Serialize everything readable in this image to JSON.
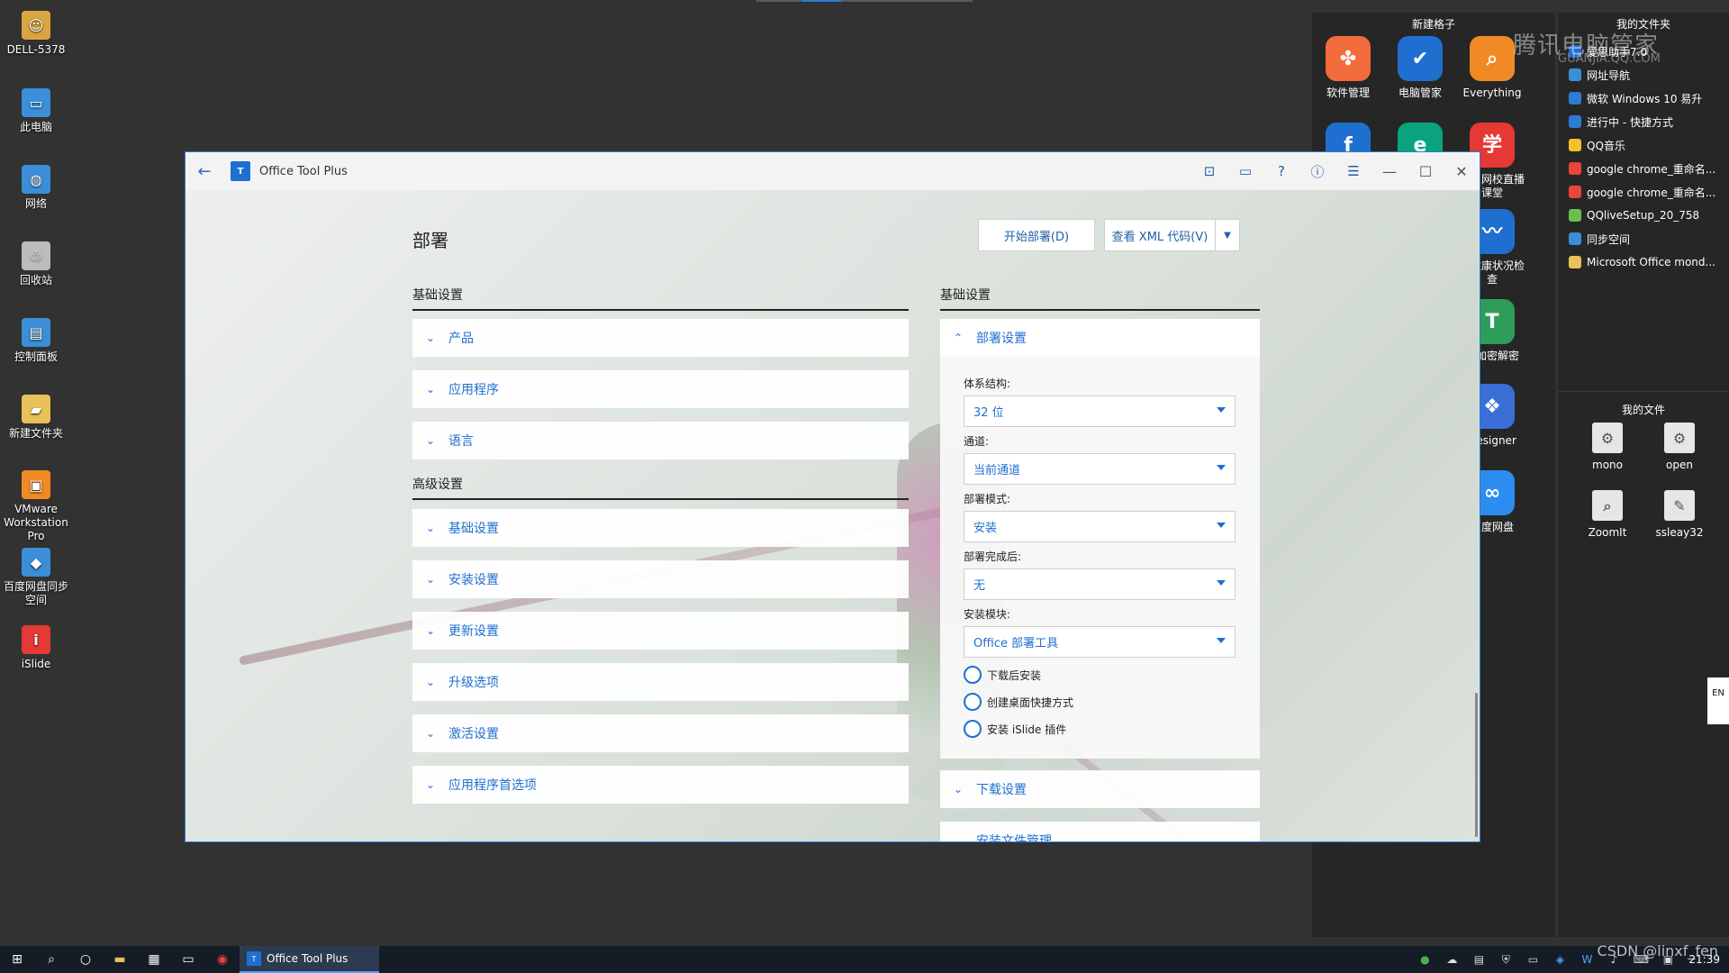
{
  "desktop": {
    "icons": [
      {
        "label": "DELL-5378",
        "icon": "user-folder-icon",
        "color": "#d9a441"
      },
      {
        "label": "此电脑",
        "icon": "computer-icon",
        "color": "#3a8fd8"
      },
      {
        "label": "网络",
        "icon": "network-icon",
        "color": "#3a8fd8"
      },
      {
        "label": "回收站",
        "icon": "recycle-bin-icon",
        "color": "#bcbcbc"
      },
      {
        "label": "控制面板",
        "icon": "control-panel-icon",
        "color": "#3a8fd8"
      },
      {
        "label": "新建文件夹",
        "icon": "folder-icon",
        "color": "#e8c15a"
      },
      {
        "label": "VMware Workstation Pro",
        "icon": "vmware-icon",
        "color": "#f08a24"
      },
      {
        "label": "百度网盘同步空间",
        "icon": "baidu-sync-icon",
        "color": "#3a8fd8"
      },
      {
        "label": "iSlide",
        "icon": "islide-icon",
        "color": "#e53935"
      }
    ]
  },
  "fence_left": {
    "title": "新建格子",
    "icons": [
      {
        "label": "软件管理",
        "icon": "software-manager-icon",
        "color": "#f26b3a"
      },
      {
        "label": "电脑管家",
        "icon": "pc-manager-icon",
        "color": "#1f6fd0"
      },
      {
        "label": "Everything",
        "icon": "everything-search-icon",
        "color": "#f08a24"
      },
      {
        "label": "",
        "icon": "flash-icon",
        "color": "#1f6fd0"
      },
      {
        "label": "",
        "icon": "edge-icon",
        "color": "#0aa37f"
      },
      {
        "label": "希思网校直播课堂",
        "icon": "school-icon",
        "color": "#e53935"
      },
      {
        "label": "脑健康状况检查",
        "icon": "health-check-icon",
        "color": "#1f6fd0"
      },
      {
        "label": "字加密解密",
        "icon": "encrypt-icon",
        "color": "#2e9d5a"
      },
      {
        "label": "Designer",
        "icon": "designer-icon",
        "color": "#3a6fd8"
      },
      {
        "label": "百度网盘",
        "icon": "baidu-netdisk-icon",
        "color": "#2d8cf0"
      }
    ]
  },
  "fence_right": {
    "title": "我的文件夹",
    "items": [
      {
        "label": "爱思助手7.0",
        "color": "#1f6fd0"
      },
      {
        "label": "网址导航",
        "color": "#3a8fd8"
      },
      {
        "label": "微软 Windows 10 易升",
        "color": "#2b7cd3"
      },
      {
        "label": "进行中 - 快捷方式",
        "color": "#2b7cd3"
      },
      {
        "label": "QQ音乐",
        "color": "#f5c12a"
      },
      {
        "label": "google chrome_重命名...",
        "color": "#e8453c"
      },
      {
        "label": "google chrome_重命名...",
        "color": "#e8453c"
      },
      {
        "label": "QQliveSetup_20_758",
        "color": "#6abf4b"
      },
      {
        "label": "同步空间",
        "color": "#3a8fd8"
      },
      {
        "label": "Microsoft Office mond...",
        "color": "#e8c15a"
      }
    ],
    "files_title": "我的文件",
    "files": [
      {
        "label": "mono",
        "icon": "settings-file-icon"
      },
      {
        "label": "open",
        "icon": "settings-file-icon"
      },
      {
        "label": "ZoomIt",
        "icon": "zoomit-icon"
      },
      {
        "label": "ssleay32",
        "icon": "python-file-icon"
      }
    ]
  },
  "watermark": {
    "line1": "腾讯电脑管家",
    "line2": "GUANJIA.QQ.COM"
  },
  "ime": "EN",
  "window": {
    "title": "Office Tool Plus",
    "logo_text": "T",
    "page_title": "部署",
    "buttons": {
      "start_deploy": "开始部署(D)",
      "view_xml": "查看 XML 代码(V)"
    },
    "left_sections": [
      {
        "heading": "基础设置",
        "panels": [
          "产品",
          "应用程序",
          "语言"
        ]
      },
      {
        "heading": "高级设置",
        "panels": [
          "基础设置",
          "安装设置",
          "更新设置",
          "升级选项",
          "激活设置",
          "应用程序首选项"
        ]
      }
    ],
    "right_section": {
      "heading": "基础设置",
      "expanded_title": "部署设置",
      "fields": [
        {
          "label": "体系结构:",
          "value": "32 位"
        },
        {
          "label": "通道:",
          "value": "当前通道"
        },
        {
          "label": "部署模式:",
          "value": "安装"
        },
        {
          "label": "部署完成后:",
          "value": "无"
        },
        {
          "label": "安装模块:",
          "value": "Office 部署工具"
        }
      ],
      "options": [
        {
          "label": "下载后安装",
          "checked": false
        },
        {
          "label": "创建桌面快捷方式",
          "checked": false
        },
        {
          "label": "安装 iSlide 插件",
          "checked": false
        }
      ],
      "collapsed": [
        "下载设置",
        "安装文件管理"
      ]
    }
  },
  "taskbar": {
    "active_app": "Office Tool Plus",
    "time": "21:39",
    "watermark": "CSDN @linxf_fen"
  },
  "colors": {
    "accent": "#1f6fd0",
    "window_border": "#2b7cd3",
    "taskbar": "#141c26"
  }
}
